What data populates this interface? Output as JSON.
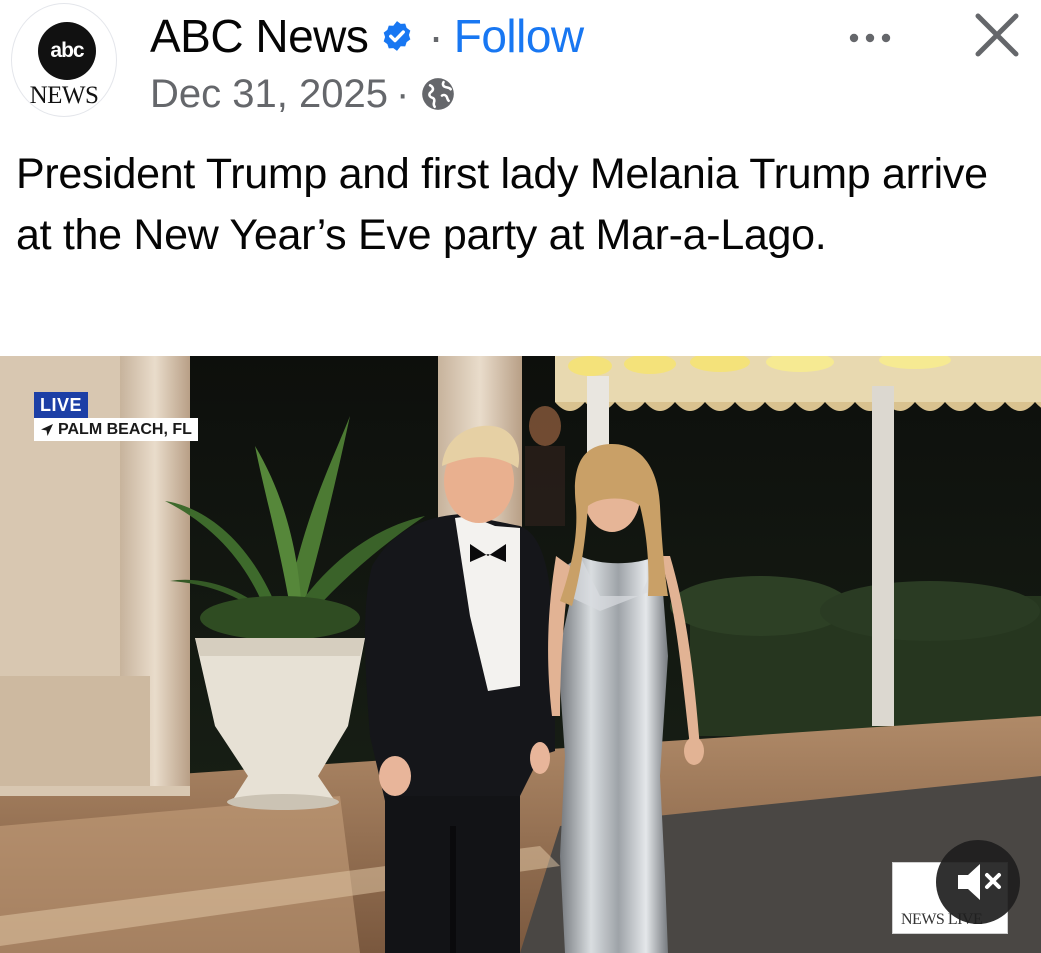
{
  "post": {
    "page_name": "ABC News",
    "follow_label": "Follow",
    "date": "Dec 31, 2025",
    "avatar_logo_text": "abc",
    "avatar_subtext": "NEWS",
    "caption": "President Trump and first lady Melania Trump arrive at the New Year’s Eve party at Mar-a-Lago.",
    "separator": "·"
  },
  "media": {
    "live_label": "LIVE",
    "location_label": "PALM BEACH, FL",
    "watermark_text": "NEWS LIVE"
  },
  "icons": {
    "verified": "verified-badge-icon",
    "privacy": "globe-icon",
    "more": "more-options-icon",
    "close": "close-icon",
    "mute": "speaker-muted-icon",
    "location": "location-arrow-icon"
  },
  "colors": {
    "link_blue": "#1877f2",
    "secondary_text": "#65676b",
    "live_badge": "#1c3fa6"
  }
}
